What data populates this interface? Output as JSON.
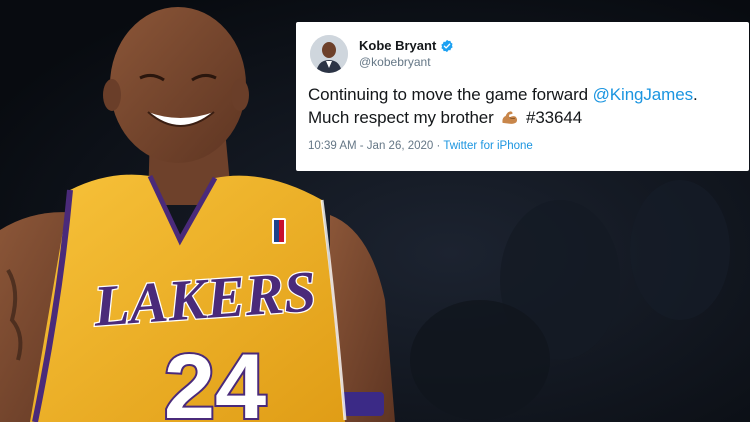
{
  "tweet": {
    "display_name": "Kobe Bryant",
    "handle": "@kobebryant",
    "text_part1": "Continuing to move the game forward ",
    "mention": "@KingJames",
    "text_part2": ".",
    "text_line2": "Much respect my brother",
    "hashtag": "#33644",
    "timestamp": "10:39 AM - Jan 26, 2020",
    "separator": " · ",
    "source": "Twitter for iPhone",
    "emoji": "flexed-biceps",
    "verified": true
  },
  "photo": {
    "jersey_team": "LAKERS",
    "jersey_number": "24",
    "colors": {
      "jersey": "#f3b22a",
      "jersey_trim": "#4a2a7a",
      "skin": "#7a4a33",
      "background": "#0d1118"
    }
  },
  "colors": {
    "link": "#1b95e0",
    "text": "#14171a",
    "muted": "#657786",
    "verified": "#1da1f2"
  }
}
